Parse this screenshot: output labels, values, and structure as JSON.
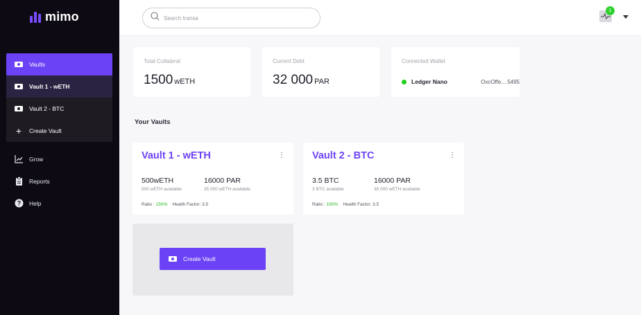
{
  "app": {
    "logo_text": "mimo"
  },
  "search": {
    "placeholder": "Search transa",
    "value": ""
  },
  "notifications": {
    "count": "1"
  },
  "sidebar": {
    "vaults_label": "Vaults",
    "vault_items": [
      {
        "label": "Vault 1 - wETH"
      },
      {
        "label": "Vault 2 - BTC"
      },
      {
        "label": "Create Vault"
      }
    ],
    "nav": [
      {
        "label": "Grow",
        "icon": "chart-line-icon"
      },
      {
        "label": "Reports",
        "icon": "clipboard-icon"
      },
      {
        "label": "Help",
        "icon": "help-icon"
      }
    ]
  },
  "stats": {
    "collateral": {
      "label": "Total Collateral",
      "value": "1500",
      "unit": "wETH"
    },
    "debt": {
      "label": "Current Debt",
      "value": "32 000",
      "unit": "PAR"
    },
    "wallet": {
      "label": "Connected Wallet",
      "name": "Ledger Nano",
      "address": "OxcOffe....5495",
      "status_color": "#1fd11f"
    }
  },
  "section_title": "Your Vaults",
  "vaults": [
    {
      "title": "Vault 1 - wETH",
      "collateral": "500wETH",
      "collateral_sub": "500 wETH available",
      "debt": "16000 PAR",
      "debt_sub": "35 000 wETH available",
      "ratio_label": "Ratio :",
      "ratio_value": "150%",
      "health": "Health Factor: 3.5"
    },
    {
      "title": "Vault 2 - BTC",
      "collateral": "3.5 BTC",
      "collateral_sub": "3 BTC available",
      "debt": "16000 PAR",
      "debt_sub": "35 000 wETH available",
      "ratio_label": "Ratio :",
      "ratio_value": "150%",
      "health": "Health Factor: 3.5"
    }
  ],
  "create_button": {
    "label": "Create Vault"
  },
  "colors": {
    "accent": "#6b42f5",
    "sidebar_bg": "#0d0a14",
    "success": "#1fd11f"
  }
}
